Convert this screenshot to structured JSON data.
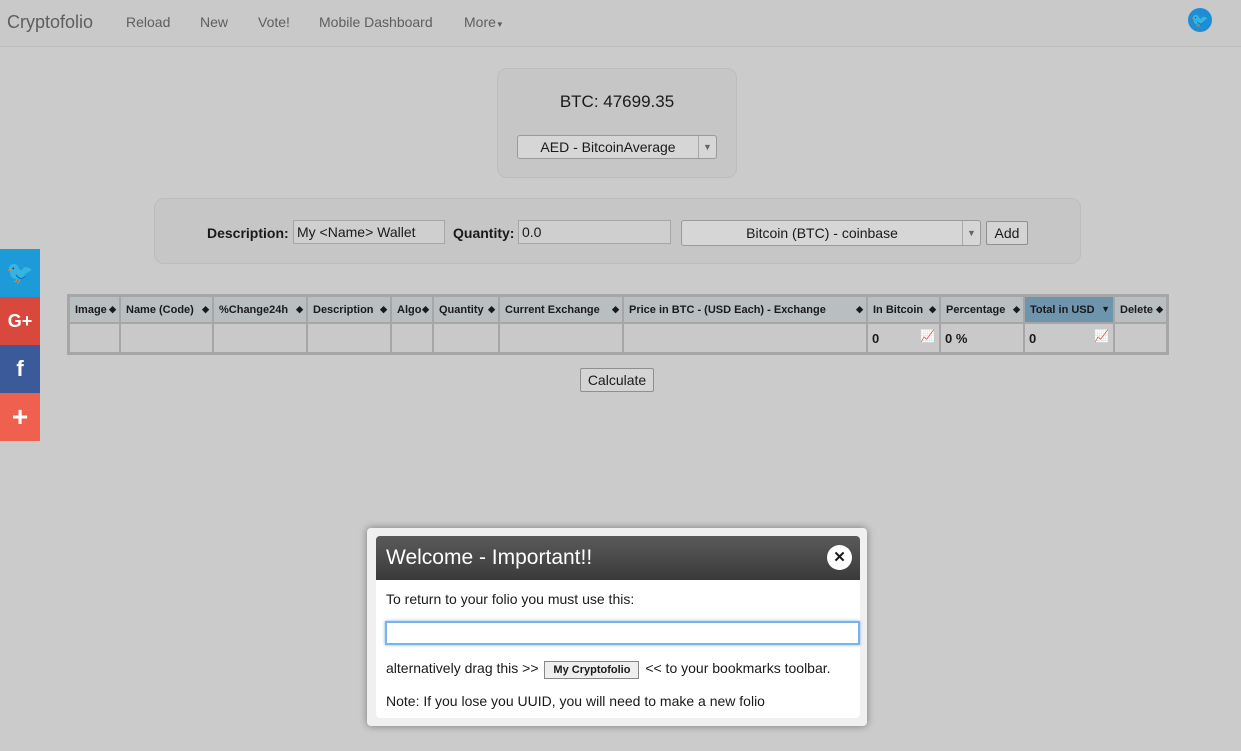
{
  "nav": {
    "brand": "Cryptofolio",
    "items": [
      "Reload",
      "New",
      "Vote!",
      "Mobile Dashboard",
      "More"
    ],
    "twitter_icon": "twitter-icon"
  },
  "btc": {
    "label": "BTC: 47699.35",
    "currency_select": "AED - BitcoinAverage"
  },
  "form": {
    "description_label": "Description:",
    "description_value": "My <Name> Wallet",
    "quantity_label": "Quantity:",
    "quantity_value": "0.0",
    "coin_select": "Bitcoin (BTC) - coinbase",
    "add_label": "Add"
  },
  "table": {
    "headers": [
      "Image",
      "Name (Code)",
      "%Change24h",
      "Description",
      "Algo",
      "Quantity",
      "Current Exchange",
      "Price in BTC - (USD Each) - Exchange",
      "In Bitcoin",
      "Percentage",
      "Total in USD",
      "Delete"
    ],
    "sorted_column": "Total in USD",
    "totals": {
      "in_bitcoin": "0",
      "percentage": "0 %",
      "total_usd": "0"
    }
  },
  "calculate_label": "Calculate",
  "social": [
    {
      "name": "twitter",
      "glyph": "🐦",
      "color": "#1d9bd8"
    },
    {
      "name": "google-plus",
      "glyph": "G+",
      "color": "#d8483d"
    },
    {
      "name": "facebook",
      "glyph": "f",
      "color": "#3b5a99"
    },
    {
      "name": "share",
      "glyph": "+",
      "color": "#f0604e"
    }
  ],
  "modal": {
    "title": "Welcome - Important!!",
    "line1": "To return to your folio you must use this:",
    "uuid_value": "",
    "drag_prefix": "alternatively drag this >>",
    "bookmark_label": "My Cryptofolio",
    "drag_suffix": "<< to your bookmarks toolbar.",
    "note": "Note: If you lose you UUID, you will need to make a new folio"
  }
}
